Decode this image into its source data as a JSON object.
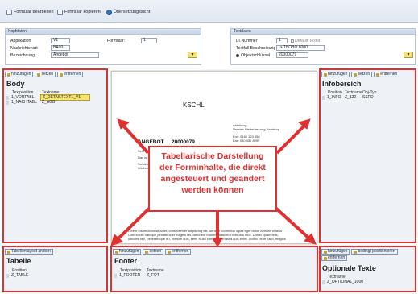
{
  "toolbar": {
    "edit": "Formular bearbeiten",
    "copy": "Formular kopieren",
    "overview": "Übersetzungssicht"
  },
  "kopfdaten": {
    "title": "Kopfdaten",
    "applikation_label": "Applikation",
    "applikation_value": "V1",
    "nachrichtenart_label": "Nachrichtenart",
    "nachrichtenart_value": "BA00",
    "bezeichnung_label": "Bezeichnung",
    "bezeichnung_value": "Angebot",
    "formular_label": "Formular:",
    "formular_value": "1"
  },
  "textdaten": {
    "title": "Textdaten",
    "lt_nummer_label": "LT.Nummer",
    "lt_nummer_value": "1",
    "default_label": "Default Textid",
    "textfall_label": "Textfall Beschreibung",
    "textfall_value": "-> TBOBO 8000",
    "objekt_label": "Objektschlüssel",
    "objekt_value": "20000079"
  },
  "buttons": {
    "add": "hinzufügen",
    "set": "setzen",
    "remove": "entfernen",
    "layout": "Tabellenlayout ändern",
    "cond": "bedingt positionieren"
  },
  "body": {
    "title": "Body",
    "col_pos": "Textposition",
    "col_name": "Textname",
    "rows": [
      {
        "pos": "1_VORTABL",
        "name": "Z_DETAILTEXT1_V1"
      },
      {
        "pos": "1_NACHTABL",
        "name": "Z_AGB"
      }
    ]
  },
  "info": {
    "title": "Infobereich",
    "col_pos": "Position",
    "col_name": "Textname",
    "col_type": "Obj-Typ",
    "rows": [
      {
        "pos": "1_INFO",
        "name": "Z_122",
        "type": "SSFO"
      }
    ]
  },
  "tabelle": {
    "title": "Tabelle",
    "col_pos": "Position",
    "rows": [
      {
        "pos": "Z_TABLE"
      }
    ]
  },
  "footer": {
    "title": "Footer",
    "col_pos": "Textposition",
    "col_name": "Textname",
    "rows": [
      {
        "pos": "1_FOOTER",
        "name": "Z_FOT"
      }
    ]
  },
  "optional": {
    "title": "Optionale Texte",
    "col_name": "Textname",
    "rows": [
      {
        "name": "Z_OPTIONAL_1000"
      }
    ]
  },
  "doc": {
    "kschl": "KSCHL",
    "abteilung": "Abteilung:",
    "addr": "Vertrieb Niederlassung Hamburg",
    "tel": "Fon: 0160 123 456",
    "fax": "Fax: 040 456 8999",
    "vaors": "VAORS: 4000",
    "angebot": "ANGEBOT",
    "number": "20000079",
    "greeting": "Sehr geehrte Damen,",
    "line1": "Das ist ein besonderes Hinweis vom 19.03.2015",
    "line2": "Solide Abwicklung",
    "line3": "Wir haben",
    "lorem1": "Lorem ipsum dolor sit amet, consectetuer adipiscing elit. Aenean commodo ligula eget dolor. Aenean massa.",
    "lorem2": "Cum sociis natoque penatibus et magnis dis parturient montes, nascetur ridiculus mus. Donec quam felis,",
    "lorem3": "ultricies nec, pellentesque eu, pretium quis, sem. Nulla consequat massa quis enim. Donec pede justo, fringilla"
  },
  "callout": "Tabellarische Darstellung der Forminhalte, die direkt angesteuert und geändert werden können",
  "colors": {
    "arrow": "#e03030",
    "highlight": "#f7e46a"
  }
}
